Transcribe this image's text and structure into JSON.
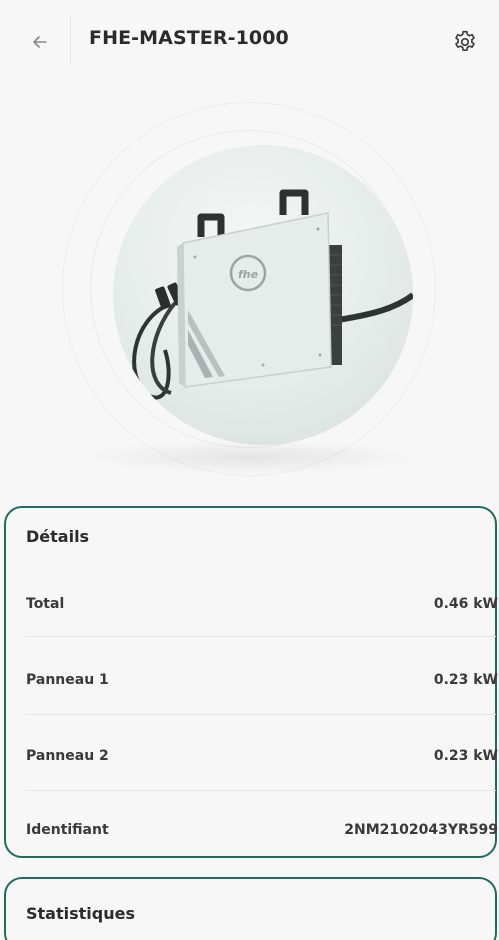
{
  "header": {
    "title": "FHE-MASTER-1000"
  },
  "hero": {
    "image_alt": "fhe"
  },
  "details": {
    "title": "Détails",
    "rows": [
      {
        "label": "Total",
        "value": "0.46 kW"
      },
      {
        "label": "Panneau 1",
        "value": "0.23 kW"
      },
      {
        "label": "Panneau 2",
        "value": "0.23 kW"
      },
      {
        "label": "Identifiant",
        "value": "2NM2102043YR599"
      }
    ]
  },
  "statistics": {
    "title": "Statistiques"
  },
  "colors": {
    "accent": "#1f6b62",
    "background": "#f7f7f7",
    "text": "#2b2b2b"
  }
}
